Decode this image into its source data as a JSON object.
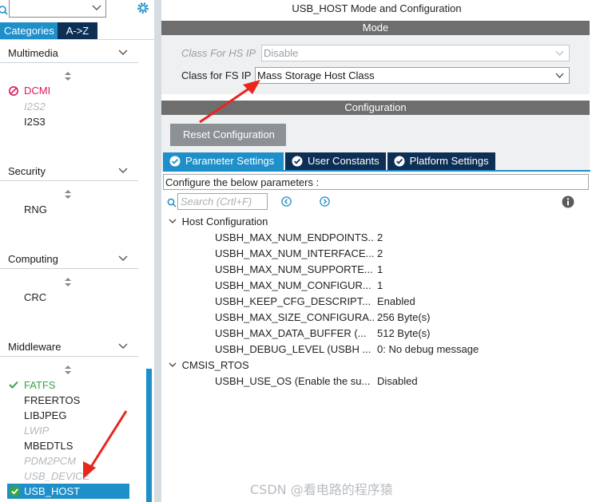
{
  "left": {
    "category_select_value": "",
    "tabs": {
      "categories": "Categories",
      "az": "A->Z"
    },
    "categories": [
      {
        "name": "Multimedia",
        "items": [
          {
            "label": "DCMI",
            "state": "error"
          },
          {
            "label": "I2S2",
            "state": "disabled"
          },
          {
            "label": "I2S3",
            "state": "normal"
          }
        ]
      },
      {
        "name": "Security",
        "items": [
          {
            "label": "RNG",
            "state": "normal"
          }
        ]
      },
      {
        "name": "Computing",
        "items": [
          {
            "label": "CRC",
            "state": "normal"
          }
        ]
      },
      {
        "name": "Middleware",
        "items": [
          {
            "label": "FATFS",
            "state": "ok"
          },
          {
            "label": "FREERTOS",
            "state": "normal"
          },
          {
            "label": "LIBJPEG",
            "state": "normal"
          },
          {
            "label": "LWIP",
            "state": "disabled"
          },
          {
            "label": "MBEDTLS",
            "state": "normal"
          },
          {
            "label": "PDM2PCM",
            "state": "disabled"
          },
          {
            "label": "USB_DEVICE",
            "state": "disabled"
          },
          {
            "label": "USB_HOST",
            "state": "selected-ok"
          }
        ]
      }
    ]
  },
  "main": {
    "title": "USB_HOST Mode and Configuration",
    "mode_header": "Mode",
    "fields": [
      {
        "label": "Class For HS IP",
        "value": "Disable",
        "enabled": false
      },
      {
        "label": "Class for FS IP",
        "value": "Mass Storage Host Class",
        "enabled": true
      }
    ],
    "config_header": "Configuration",
    "reset_button": "Reset Configuration",
    "tabs": [
      "Parameter Settings",
      "User Constants",
      "Platform Settings"
    ],
    "instructions": "Configure the below parameters :",
    "search_placeholder": "Search (Crtl+F)",
    "groups": [
      {
        "name": "Host Configuration",
        "params": [
          {
            "key": "USBH_MAX_NUM_ENDPOINTS...",
            "value": "2"
          },
          {
            "key": "USBH_MAX_NUM_INTERFACE...",
            "value": "2"
          },
          {
            "key": "USBH_MAX_NUM_SUPPORTE...",
            "value": "1"
          },
          {
            "key": "USBH_MAX_NUM_CONFIGUR...",
            "value": "1"
          },
          {
            "key": "USBH_KEEP_CFG_DESCRIPT...",
            "value": "Enabled"
          },
          {
            "key": "USBH_MAX_SIZE_CONFIGURA...",
            "value": "256 Byte(s)"
          },
          {
            "key": "USBH_MAX_DATA_BUFFER (...",
            "value": "512 Byte(s)"
          },
          {
            "key": "USBH_DEBUG_LEVEL (USBH ...",
            "value": "0: No debug message"
          }
        ]
      },
      {
        "name": "CMSIS_RTOS",
        "params": [
          {
            "key": "USBH_USE_OS (Enable the su...",
            "value": "Disabled"
          }
        ]
      }
    ]
  },
  "watermark": "CSDN @看电路的程序猿",
  "colors": {
    "accent": "#1e8fc9",
    "dark_tab": "#0d2f55",
    "section_bar": "#6e6e6e",
    "annotation_arrow": "#e8261e",
    "ok": "#3aa24b",
    "error": "#e0185b"
  }
}
